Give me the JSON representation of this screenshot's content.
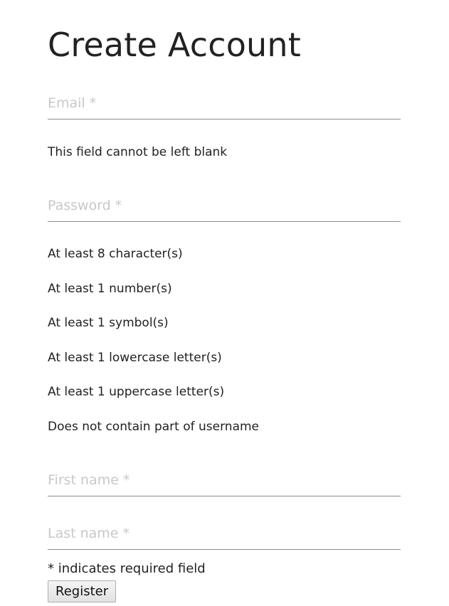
{
  "page": {
    "title": "Create Account"
  },
  "form": {
    "email": {
      "placeholder": "Email *",
      "value": "",
      "error": "This field cannot be left blank"
    },
    "password": {
      "placeholder": "Password *",
      "value": "",
      "rules": [
        "At least 8 character(s)",
        "At least 1 number(s)",
        "At least 1 symbol(s)",
        "At least 1 lowercase letter(s)",
        "At least 1 uppercase letter(s)",
        "Does not contain part of username"
      ]
    },
    "first_name": {
      "placeholder": "First name *",
      "value": ""
    },
    "last_name": {
      "placeholder": "Last name *",
      "value": ""
    },
    "required_note": "* indicates required field",
    "register_label": "Register"
  }
}
